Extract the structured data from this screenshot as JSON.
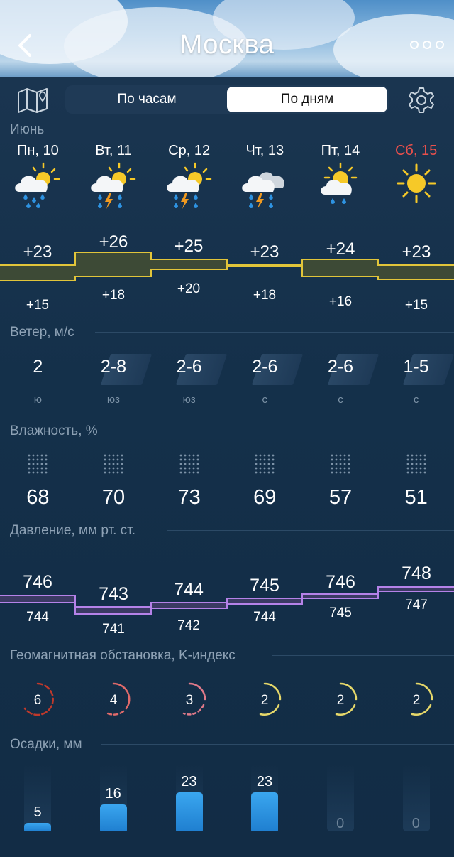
{
  "header": {
    "title": "Москва",
    "back_icon": "chevron-left-icon",
    "menu_icon": "more-icon"
  },
  "toolbar": {
    "tabs": [
      {
        "label": "По часам",
        "active": false
      },
      {
        "label": "По дням",
        "active": true
      }
    ],
    "map_icon": "map-icon",
    "settings_icon": "gear-icon"
  },
  "month": "Июнь",
  "days": [
    {
      "label": "Пн, 10",
      "weekend": false,
      "icon": "partly-cloudy-rain-icon",
      "temp_hi": "+23",
      "temp_lo": "+15",
      "wind": "2",
      "wind_dir": "ю",
      "humidity": "68",
      "press_hi": "746",
      "press_lo": "744",
      "k_index": "6",
      "precip": "5",
      "precip_mm": 5
    },
    {
      "label": "Вт, 11",
      "weekend": false,
      "icon": "partly-cloudy-thunder-icon",
      "temp_hi": "+26",
      "temp_lo": "+18",
      "wind": "2-8",
      "wind_dir": "юз",
      "humidity": "70",
      "press_hi": "743",
      "press_lo": "741",
      "k_index": "4",
      "precip": "16",
      "precip_mm": 16
    },
    {
      "label": "Ср, 12",
      "weekend": false,
      "icon": "partly-cloudy-thunder-icon",
      "temp_hi": "+25",
      "temp_lo": "+20",
      "wind": "2-6",
      "wind_dir": "юз",
      "humidity": "73",
      "press_hi": "744",
      "press_lo": "742",
      "k_index": "3",
      "precip": "23",
      "precip_mm": 23
    },
    {
      "label": "Чт, 13",
      "weekend": false,
      "icon": "cloudy-thunder-icon",
      "temp_hi": "+23",
      "temp_lo": "+18",
      "wind": "2-6",
      "wind_dir": "с",
      "humidity": "69",
      "press_hi": "745",
      "press_lo": "744",
      "k_index": "2",
      "precip": "23",
      "precip_mm": 23
    },
    {
      "label": "Пт, 14",
      "weekend": false,
      "icon": "partly-cloudy-light-rain-icon",
      "temp_hi": "+24",
      "temp_lo": "+16",
      "wind": "2-6",
      "wind_dir": "с",
      "humidity": "57",
      "press_hi": "746",
      "press_lo": "745",
      "k_index": "2",
      "precip": "0",
      "precip_mm": 0
    },
    {
      "label": "Сб, 15",
      "weekend": true,
      "icon": "sun-icon",
      "temp_hi": "+23",
      "temp_lo": "+15",
      "wind": "1-5",
      "wind_dir": "с",
      "humidity": "51",
      "press_hi": "748",
      "press_lo": "747",
      "k_index": "2",
      "precip": "0",
      "precip_mm": 0
    }
  ],
  "sections": {
    "wind": "Ветер, м/с",
    "humidity": "Влажность, %",
    "pressure": "Давление, мм рт. ст.",
    "geomagnetic": "Геомагнитная обстановка, K-индекс",
    "precipitation": "Осадки, мм"
  },
  "colors": {
    "weekend": "#e9504c",
    "temp_band": "#e1c53a",
    "pressure_band": "#b582e8",
    "precip_bar": "#2e93e2",
    "k_high": "#c0392b",
    "k_mid": "#e06a6a",
    "k_low": "#e6d86a"
  }
}
